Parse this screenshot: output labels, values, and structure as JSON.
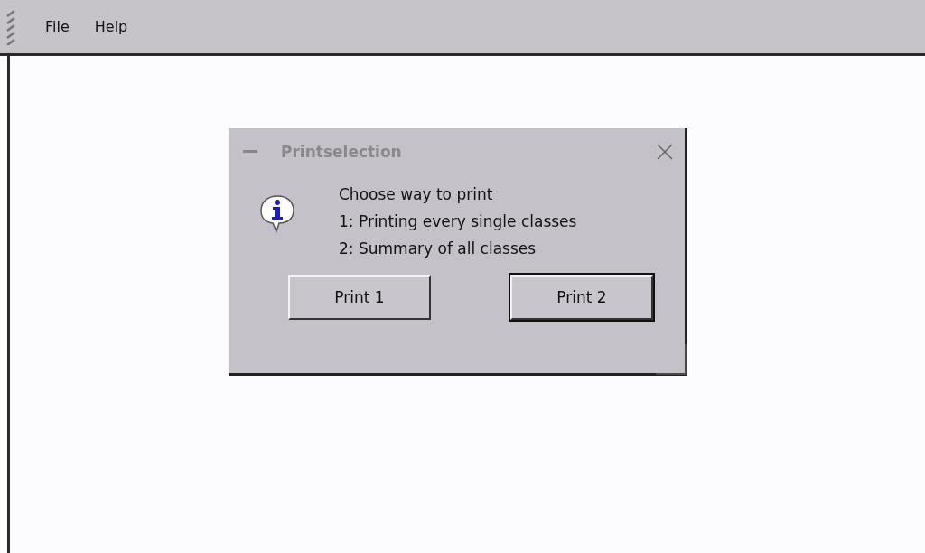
{
  "menu": [
    {
      "label": "File"
    },
    {
      "label": "Help"
    }
  ],
  "dialog": {
    "title": "Printselection",
    "active": false,
    "message_lines": [
      "Choose way to print",
      "1: Printing every single classes",
      "2: Summary of all classes"
    ],
    "buttons": [
      {
        "label": "Print 1",
        "default": false
      },
      {
        "label": "Print 2",
        "default": true
      }
    ]
  }
}
